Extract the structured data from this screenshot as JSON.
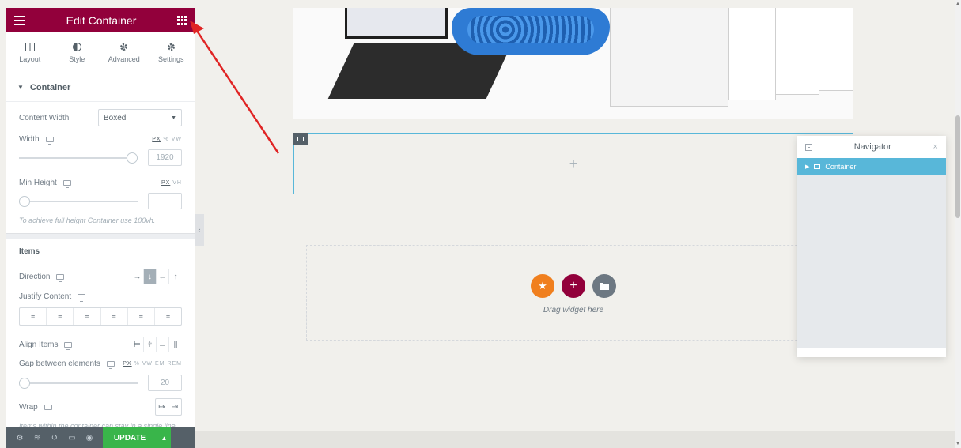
{
  "panel": {
    "title": "Edit Container",
    "tabs": [
      {
        "label": "Layout",
        "icon": "layout-icon"
      },
      {
        "label": "Style",
        "icon": "style-icon"
      },
      {
        "label": "Advanced",
        "icon": "gear-icon"
      },
      {
        "label": "Settings",
        "icon": "gear-icon"
      }
    ],
    "container_section": {
      "title": "Container",
      "content_width_label": "Content Width",
      "content_width_value": "Boxed",
      "width_label": "Width",
      "width_units": [
        "PX",
        "%",
        "VW"
      ],
      "width_value": "1920",
      "width_slider_fraction": 1.0,
      "min_height_label": "Min Height",
      "min_height_units": [
        "PX",
        "VH"
      ],
      "min_height_value": "",
      "min_height_slider_fraction": 0.0,
      "min_height_hint": "To achieve full height Container use 100vh."
    },
    "items_section": {
      "title": "Items",
      "direction_label": "Direction",
      "direction_buttons": [
        "→",
        "↓",
        "←",
        "↑"
      ],
      "direction_active_index": 1,
      "justify_label": "Justify Content",
      "justify_buttons": [
        "≡",
        "≡",
        "≡",
        "≡",
        "≡",
        "≡"
      ],
      "align_label": "Align Items",
      "align_buttons": [
        "⊨",
        "⫩",
        "⫤",
        "⫼"
      ],
      "gap_label": "Gap between elements",
      "gap_units": [
        "PX",
        "%",
        "VW",
        "EM",
        "REM"
      ],
      "gap_value": "20",
      "gap_slider_fraction": 0.0,
      "wrap_label": "Wrap",
      "wrap_buttons": [
        "↦",
        "⇥"
      ],
      "wrap_hint": "Items within the container can stay in a single line (No wrap), or break into multiple lines (Wrap)."
    },
    "footer": {
      "update_label": "UPDATE",
      "icons": [
        "gear-icon",
        "layers-icon",
        "history-icon",
        "responsive-icon",
        "eye-icon"
      ]
    }
  },
  "canvas": {
    "drop_zone_text": "Drag widget here",
    "buttons": [
      {
        "name": "add-template",
        "icon": "★",
        "color": "#f07f1e"
      },
      {
        "name": "add-section",
        "icon": "+",
        "color": "#92003b"
      },
      {
        "name": "add-folder",
        "icon": "▇",
        "color": "#6d7882"
      }
    ]
  },
  "navigator": {
    "title": "Navigator",
    "close_icon": "×",
    "items": [
      {
        "label": "Container"
      }
    ],
    "resize_handle": "..."
  },
  "colors": {
    "brand": "#92003b",
    "accent": "#58b7d9",
    "update": "#39b54a",
    "arrow": "#e02424"
  }
}
